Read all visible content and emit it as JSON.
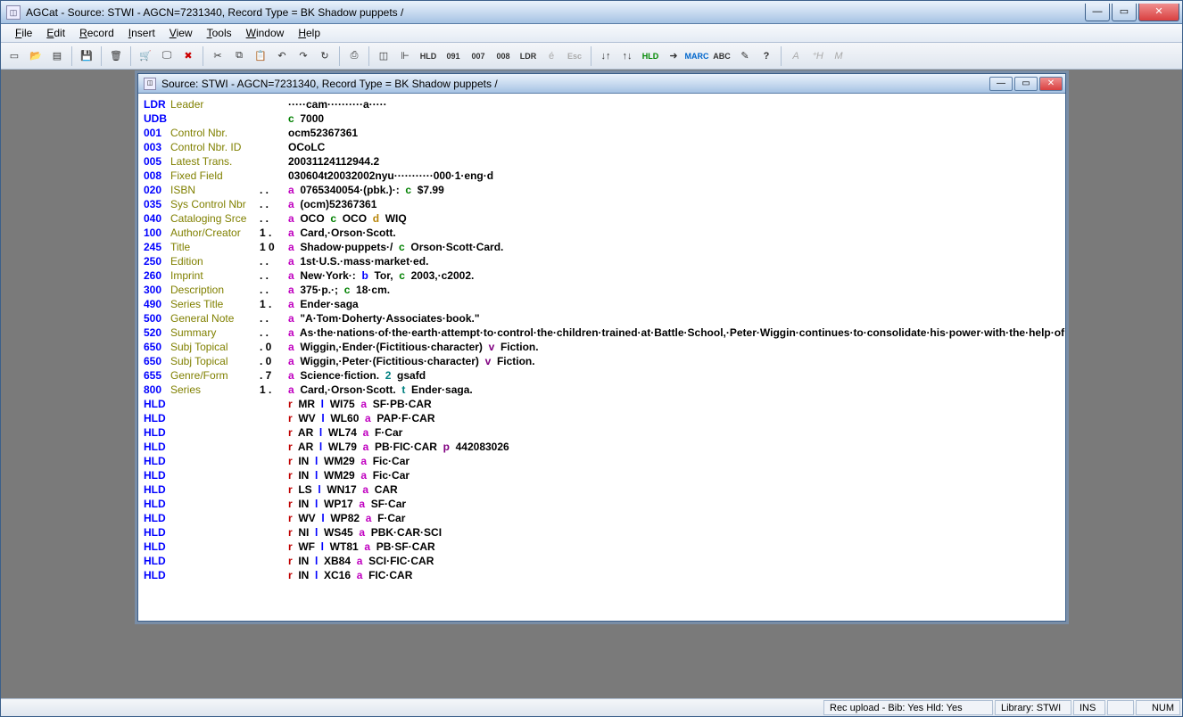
{
  "window": {
    "title": "AGCat - Source: STWI - AGCN=7231340,  Record Type = BK Shadow puppets /"
  },
  "menu": [
    "File",
    "Edit",
    "Record",
    "Insert",
    "View",
    "Tools",
    "Window",
    "Help"
  ],
  "toolbar": [
    {
      "name": "file-icon",
      "glyph": "▭"
    },
    {
      "name": "open-icon",
      "glyph": "📂"
    },
    {
      "name": "db-icon",
      "glyph": "▤"
    },
    {
      "sep": true
    },
    {
      "name": "save-icon",
      "glyph": "💾"
    },
    {
      "sep": true
    },
    {
      "name": "trash-icon",
      "glyph": "🗑"
    },
    {
      "sep": true
    },
    {
      "name": "cart-icon",
      "glyph": "🛒"
    },
    {
      "name": "monitor-icon",
      "glyph": "🖵"
    },
    {
      "name": "delete-icon",
      "glyph": "✖",
      "color": "#c00"
    },
    {
      "sep": true
    },
    {
      "name": "cut-icon",
      "glyph": "✂"
    },
    {
      "name": "copy-icon",
      "glyph": "⧉"
    },
    {
      "name": "paste-icon",
      "glyph": "📋"
    },
    {
      "name": "undo-icon",
      "glyph": "↶"
    },
    {
      "name": "redo-icon",
      "glyph": "↷"
    },
    {
      "name": "repeat-icon",
      "glyph": "↻"
    },
    {
      "sep": true
    },
    {
      "name": "print-icon",
      "glyph": "⎙"
    },
    {
      "sep": true
    },
    {
      "name": "float-icon",
      "glyph": "◫"
    },
    {
      "name": "ruler-icon",
      "glyph": "⊩"
    },
    {
      "name": "hld-btn",
      "text": "HLD"
    },
    {
      "name": "o91-btn",
      "text": "091"
    },
    {
      "name": "oo7-btn",
      "text": "007"
    },
    {
      "name": "oo8-btn",
      "text": "008"
    },
    {
      "name": "ldr-btn",
      "text": "LDR"
    },
    {
      "name": "acute-icon",
      "glyph": "é",
      "disabled": true
    },
    {
      "name": "esc-btn",
      "text": "Esc",
      "disabled": true
    },
    {
      "sep": true
    },
    {
      "name": "sort-down-icon",
      "glyph": "↓↑"
    },
    {
      "name": "sort-up-icon",
      "glyph": "↑↓"
    },
    {
      "name": "hld2-btn",
      "text": "HLD",
      "color": "#080"
    },
    {
      "name": "arrow-icon",
      "glyph": "➜"
    },
    {
      "name": "marc-btn",
      "text": "MARC",
      "color": "#06c"
    },
    {
      "name": "abc-btn",
      "text": "ABC",
      "checkish": true
    },
    {
      "name": "wand-icon",
      "glyph": "✎"
    },
    {
      "name": "help-icon",
      "glyph": "?",
      "bold": true
    },
    {
      "sep": true
    },
    {
      "name": "a-btn",
      "glyph": "A",
      "disabled": true,
      "italic": true
    },
    {
      "name": "h-btn",
      "glyph": "⁺H",
      "disabled": true,
      "italic": true
    },
    {
      "name": "m-btn",
      "glyph": "M",
      "disabled": true,
      "italic": true
    }
  ],
  "mdi": {
    "title": "Source: STWI - AGCN=7231340,  Record Type = BK Shadow puppets /"
  },
  "record": [
    {
      "tag": "LDR",
      "label": "Leader",
      "ind": "",
      "data": [
        [
          "",
          "·····cam··········a·····"
        ]
      ]
    },
    {
      "tag": "UDB",
      "label": "",
      "ind": "",
      "data": [
        [
          "c",
          "7000"
        ]
      ]
    },
    {
      "tag": "001",
      "label": "Control Nbr.",
      "ind": "",
      "data": [
        [
          "",
          "ocm52367361"
        ]
      ]
    },
    {
      "tag": "003",
      "label": "Control Nbr. ID",
      "ind": "",
      "data": [
        [
          "",
          "OCoLC"
        ]
      ]
    },
    {
      "tag": "005",
      "label": "Latest Trans.",
      "ind": "",
      "data": [
        [
          "",
          "20031124112944.2"
        ]
      ]
    },
    {
      "tag": "008",
      "label": "Fixed Field",
      "ind": "",
      "data": [
        [
          "",
          "030604t20032002nyu···········000·1·eng·d"
        ]
      ]
    },
    {
      "tag": "020",
      "label": "ISBN",
      "ind": ". .",
      "data": [
        [
          "a",
          "0765340054·(pbk.)·:"
        ],
        [
          "c",
          "$7.99"
        ]
      ]
    },
    {
      "tag": "035",
      "label": "Sys Control Nbr",
      "ind": ". .",
      "data": [
        [
          "a",
          "(ocm)52367361"
        ]
      ]
    },
    {
      "tag": "040",
      "label": "Cataloging Srce",
      "ind": ". .",
      "data": [
        [
          "a",
          "OCO"
        ],
        [
          "c",
          "OCO"
        ],
        [
          "d",
          "WIQ"
        ]
      ]
    },
    {
      "tag": "100",
      "label": "Author/Creator",
      "ind": "1 .",
      "data": [
        [
          "a",
          "Card,·Orson·Scott."
        ]
      ]
    },
    {
      "tag": "245",
      "label": "Title",
      "ind": "1 0",
      "data": [
        [
          "a",
          "Shadow·puppets·/"
        ],
        [
          "c",
          "Orson·Scott·Card."
        ]
      ]
    },
    {
      "tag": "250",
      "label": "Edition",
      "ind": ". .",
      "data": [
        [
          "a",
          "1st·U.S.·mass·market·ed."
        ]
      ]
    },
    {
      "tag": "260",
      "label": "Imprint",
      "ind": ". .",
      "data": [
        [
          "a",
          "New·York·:"
        ],
        [
          "b",
          "Tor,"
        ],
        [
          "c",
          "2003,·c2002."
        ]
      ]
    },
    {
      "tag": "300",
      "label": "Description",
      "ind": ". .",
      "data": [
        [
          "a",
          "375·p.·;"
        ],
        [
          "c",
          "18·cm."
        ]
      ]
    },
    {
      "tag": "490",
      "label": "Series Title",
      "ind": "1 .",
      "data": [
        [
          "a",
          "Ender·saga"
        ]
      ]
    },
    {
      "tag": "500",
      "label": "General Note",
      "ind": ". .",
      "data": [
        [
          "a",
          "\"A·Tom·Doherty·Associates·book.\""
        ]
      ]
    },
    {
      "tag": "520",
      "label": "Summary",
      "ind": ". .",
      "data": [
        [
          "a",
          "As·the·nations·of·the·earth·attempt·to·control·the·children·trained·at·Battle·School,·Peter·Wiggin·continues·to·consolidate·his·power·with·the·help·of·Bean·and·Petra."
        ]
      ]
    },
    {
      "tag": "650",
      "label": "Subj Topical",
      "ind": ". 0",
      "data": [
        [
          "a",
          "Wiggin,·Ender·(Fictitious·character)"
        ],
        [
          "v",
          "Fiction."
        ]
      ]
    },
    {
      "tag": "650",
      "label": "Subj Topical",
      "ind": ". 0",
      "data": [
        [
          "a",
          "Wiggin,·Peter·(Fictitious·character)"
        ],
        [
          "v",
          "Fiction."
        ]
      ]
    },
    {
      "tag": "655",
      "label": "Genre/Form",
      "ind": ". 7",
      "data": [
        [
          "a",
          "Science·fiction."
        ],
        [
          "2",
          "gsafd"
        ]
      ]
    },
    {
      "tag": "800",
      "label": "Series",
      "ind": "1 .",
      "data": [
        [
          "a",
          "Card,·Orson·Scott."
        ],
        [
          "t",
          "Ender·saga."
        ]
      ]
    },
    {
      "tag": "HLD",
      "label": "",
      "ind": "",
      "data": [
        [
          "r",
          "MR"
        ],
        [
          "l",
          "WI75"
        ],
        [
          "a",
          "SF·PB·CAR"
        ]
      ]
    },
    {
      "tag": "HLD",
      "label": "",
      "ind": "",
      "data": [
        [
          "r",
          "WV"
        ],
        [
          "l",
          "WL60"
        ],
        [
          "a",
          "PAP·F·CAR"
        ]
      ]
    },
    {
      "tag": "HLD",
      "label": "",
      "ind": "",
      "data": [
        [
          "r",
          "AR"
        ],
        [
          "l",
          "WL74"
        ],
        [
          "a",
          "F·Car"
        ]
      ]
    },
    {
      "tag": "HLD",
      "label": "",
      "ind": "",
      "data": [
        [
          "r",
          "AR"
        ],
        [
          "l",
          "WL79"
        ],
        [
          "a",
          "PB·FIC·CAR"
        ],
        [
          "p",
          "442083026"
        ]
      ]
    },
    {
      "tag": "HLD",
      "label": "",
      "ind": "",
      "data": [
        [
          "r",
          "IN"
        ],
        [
          "l",
          "WM29"
        ],
        [
          "a",
          "Fic·Car"
        ]
      ]
    },
    {
      "tag": "HLD",
      "label": "",
      "ind": "",
      "data": [
        [
          "r",
          "IN"
        ],
        [
          "l",
          "WM29"
        ],
        [
          "a",
          "Fic·Car"
        ]
      ]
    },
    {
      "tag": "HLD",
      "label": "",
      "ind": "",
      "data": [
        [
          "r",
          "LS"
        ],
        [
          "l",
          "WN17"
        ],
        [
          "a",
          "CAR"
        ]
      ]
    },
    {
      "tag": "HLD",
      "label": "",
      "ind": "",
      "data": [
        [
          "r",
          "IN"
        ],
        [
          "l",
          "WP17"
        ],
        [
          "a",
          "SF·Car"
        ]
      ]
    },
    {
      "tag": "HLD",
      "label": "",
      "ind": "",
      "data": [
        [
          "r",
          "WV"
        ],
        [
          "l",
          "WP82"
        ],
        [
          "a",
          "F·Car"
        ]
      ]
    },
    {
      "tag": "HLD",
      "label": "",
      "ind": "",
      "data": [
        [
          "r",
          "NI"
        ],
        [
          "l",
          "WS45"
        ],
        [
          "a",
          "PBK·CAR·SCI"
        ]
      ]
    },
    {
      "tag": "HLD",
      "label": "",
      "ind": "",
      "data": [
        [
          "r",
          "WF"
        ],
        [
          "l",
          "WT81"
        ],
        [
          "a",
          "PB·SF·CAR"
        ]
      ]
    },
    {
      "tag": "HLD",
      "label": "",
      "ind": "",
      "data": [
        [
          "r",
          "IN"
        ],
        [
          "l",
          "XB84"
        ],
        [
          "a",
          "SCI·FIC·CAR"
        ]
      ]
    },
    {
      "tag": "HLD",
      "label": "",
      "ind": "",
      "data": [
        [
          "r",
          "IN"
        ],
        [
          "l",
          "XC16"
        ],
        [
          "a",
          "FIC·CAR"
        ]
      ]
    }
  ],
  "status": {
    "rec_upload": "Rec upload - Bib: Yes  Hld: Yes",
    "library": "Library: STWI",
    "ins": "INS",
    "num": "NUM"
  }
}
